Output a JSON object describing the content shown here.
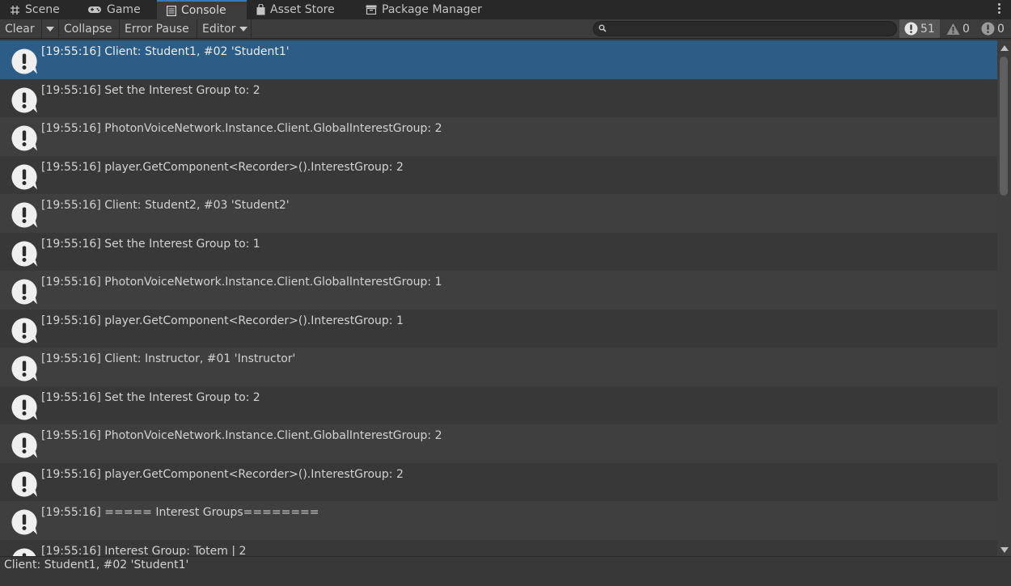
{
  "tabs": [
    {
      "label": "Scene",
      "icon": "grid-icon",
      "active": false
    },
    {
      "label": "Game",
      "icon": "gamepad-icon",
      "active": false
    },
    {
      "label": "Console",
      "icon": "console-icon",
      "active": true
    },
    {
      "label": "Asset Store",
      "icon": "shopping-bag-icon",
      "active": false
    },
    {
      "label": "Package Manager",
      "icon": "package-icon",
      "active": false
    }
  ],
  "toolbar": {
    "clear_label": "Clear",
    "collapse_label": "Collapse",
    "error_pause_label": "Error Pause",
    "editor_label": "Editor",
    "search_placeholder": "",
    "info_count": "51",
    "warning_count": "0",
    "error_count": "0"
  },
  "log": {
    "selected_index": 0,
    "entries": [
      "[19:55:16] Client: Student1, #02 'Student1'",
      "[19:55:16] Set the Interest Group to: 2",
      "[19:55:16] PhotonVoiceNetwork.Instance.Client.GlobalInterestGroup: 2",
      "[19:55:16] player.GetComponent<Recorder>().InterestGroup: 2",
      "[19:55:16] Client: Student2, #03 'Student2'",
      "[19:55:16] Set the Interest Group to: 1",
      "[19:55:16] PhotonVoiceNetwork.Instance.Client.GlobalInterestGroup: 1",
      "[19:55:16] player.GetComponent<Recorder>().InterestGroup: 1",
      "[19:55:16] Client: Instructor, #01 'Instructor'",
      "[19:55:16] Set the Interest Group to: 2",
      "[19:55:16] PhotonVoiceNetwork.Instance.Client.GlobalInterestGroup: 2",
      "[19:55:16] player.GetComponent<Recorder>().InterestGroup: 2",
      "[19:55:16] ===== Interest Groups========",
      "[19:55:16] Interest Group: Totem | 2"
    ]
  },
  "detail": {
    "text": "Client: Student1, #02 'Student1'"
  },
  "colors": {
    "selection": "#2c5d87",
    "tab_accent": "#3a79bb",
    "background": "#383838"
  }
}
